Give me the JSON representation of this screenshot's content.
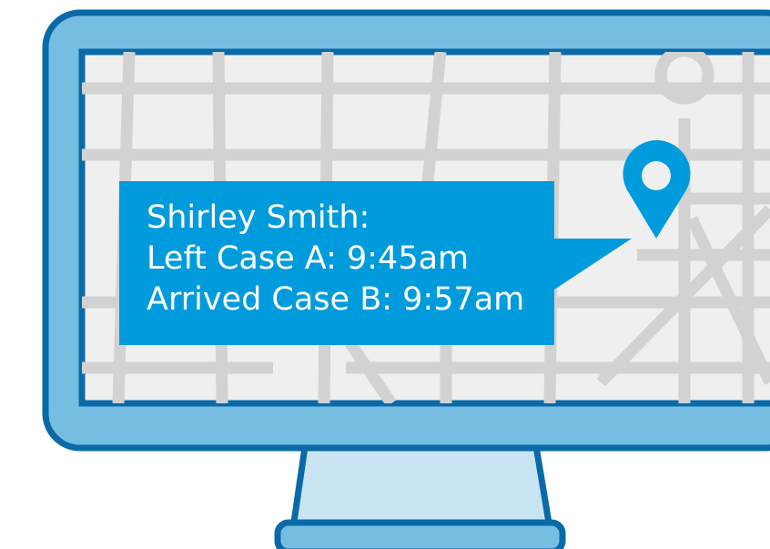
{
  "colors": {
    "bezel": "#76bde2",
    "outline": "#0a6aa8",
    "screen_background": "#efefef",
    "roads": "#d2d2d2",
    "stand": "#c9e4f2",
    "callout": "#009bdd",
    "callout_text": "#ffffff",
    "pin": "#009bdd"
  },
  "icons": {
    "monitor": "desktop-monitor-icon",
    "pin": "map-pin-icon"
  },
  "callout": {
    "line1": "Shirley Smith:",
    "line2": "Left Case A: 9:45am",
    "line3": "Arrived Case B: 9:57am"
  }
}
